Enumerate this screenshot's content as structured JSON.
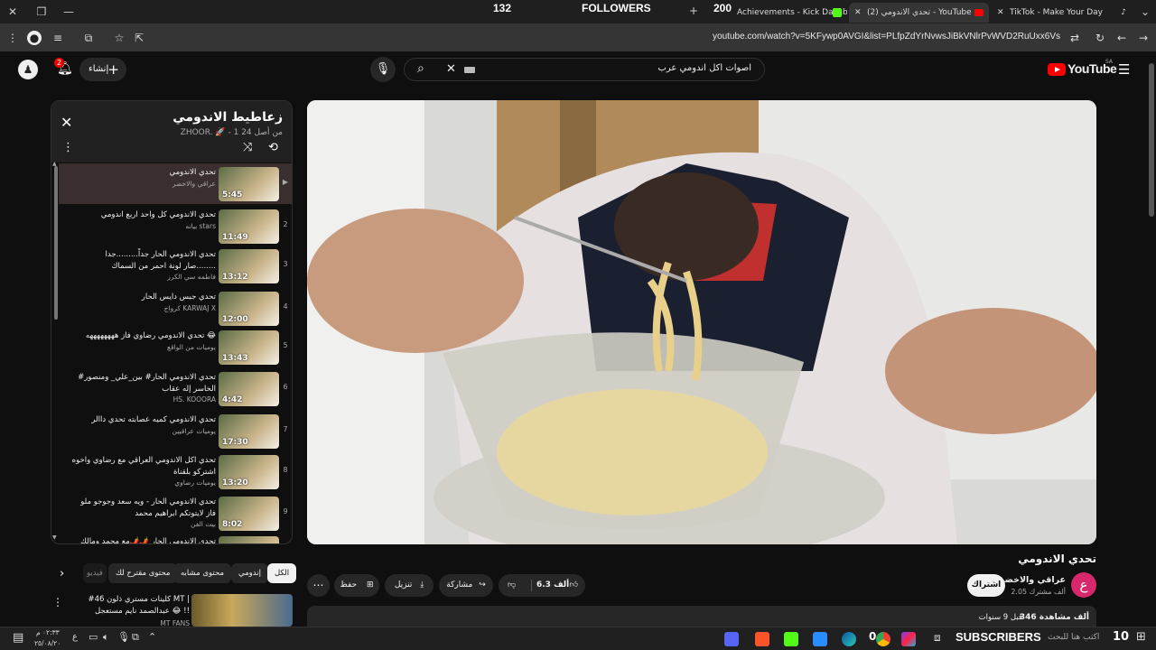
{
  "browser": {
    "tabs": [
      {
        "label": "Achievements - Kick Dashboard"
      },
      {
        "label": "(2) تحدي الاندومي - YouTube"
      },
      {
        "label": "TikTok - Make Your Day"
      }
    ],
    "overlay": {
      "followers_count": "132",
      "followers_label": "FOLLOWERS",
      "other_count": "200"
    },
    "url": "youtube.com/watch?v=5KFywp0AVGI&list=PLfpZdYrNvwsJiBkVNlrPvWVD2RuUxx6Vs"
  },
  "header": {
    "logo_text": "YouTube",
    "logo_region": "SA",
    "search_query": "اصوات اكل اندومي عرب",
    "create_label": "إنشاء",
    "notif_count": "2",
    "colors": {
      "brand_red": "#ff0000",
      "bg": "#0f0f0f"
    }
  },
  "playlist": {
    "title": "زعاطيط الاندومي",
    "subtitle": "ZHOOR. 🚀 - 1 من أصل 24",
    "items": [
      {
        "index": "▶",
        "title": "تحدي الاندومي",
        "channel": "عراقي والاخضر",
        "duration": "5:45"
      },
      {
        "index": "2",
        "title": "تحدي الاندومي كل واحد اربع اندومي",
        "channel": "بيانه stars",
        "duration": "11:49"
      },
      {
        "index": "3",
        "title": "تحدي الاندومي الحار جداً.........جدا ........صار لونة احمر من السماك",
        "channel": "فاطمه سي الكرز",
        "duration": "13:12"
      },
      {
        "index": "4",
        "title": "تحدي جبس دايس الحار",
        "channel": "كرواج KARWAJ X",
        "duration": "12:00"
      },
      {
        "index": "5",
        "title": "تحدي الاندومي رضاوي فاز ههههههههه 😂",
        "channel": "يوميات من الواقع",
        "duration": "13:43"
      },
      {
        "index": "6",
        "title": "#تحدي الاندومي الحار# بين_علي_ ومنصور الخاسر إله عقاب",
        "channel": "HS. KOOORA",
        "duration": "4:42"
      },
      {
        "index": "7",
        "title": "تحدي الاندومي كميه عصابته تحدي داالر",
        "channel": "يوميات عراقيين",
        "duration": "17:30"
      },
      {
        "index": "8",
        "title": "تحدي اكل الاندومي العراقي مع رضاوي واخوه اشتركو بلقناة",
        "channel": "يوميات رضاوي",
        "duration": "13:20"
      },
      {
        "index": "9",
        "title": "تحدي الاندومي الحار - ويه سعد وجوجو ملو فاز لايتوتكم ابراهيم محمد",
        "channel": "بيت الفن",
        "duration": "8:02"
      },
      {
        "index": "",
        "title": "تحدي الاندومي الحار 🌶️🌶️مع محمد ومالك",
        "channel": "",
        "duration": ""
      }
    ]
  },
  "chips": [
    "الكل",
    "إندومي",
    "محتوى مشابه",
    "محتوى مقترح لك",
    "فيديو"
  ],
  "recommend": {
    "title": "#46 كلينات مستري ذلون MT | عبدالصمد نايم مستعجل 😂 !!",
    "channel": "MT FANS"
  },
  "video": {
    "title": "تحدي الاندومي",
    "channel_name": "عراقي والاخضر",
    "subscribers": "2.05 ألف مشترك",
    "avatar_letter": "ع",
    "subscribe_label": "اشتراك",
    "likes": "6.3 ألف",
    "share_label": "مشاركة",
    "download_label": "تنزيل",
    "save_label": "حفظ",
    "views": "346 ألف مشاهدة",
    "age": "قبل 9 سنوات"
  },
  "taskbar": {
    "search_placeholder": "اكتب هنا للبحث",
    "time": "٠٢:٣٣ م",
    "date": "٢٥/٠٨/٢٠",
    "lang": "ع",
    "subs_label": "SUBSCRIBERS",
    "subs_count": "10",
    "zero_count": "0"
  }
}
